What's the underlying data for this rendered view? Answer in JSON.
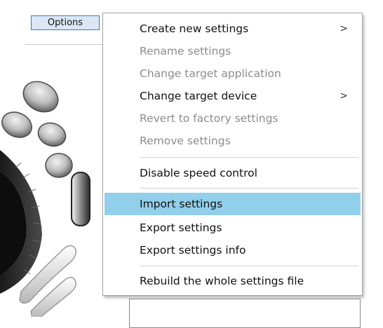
{
  "toolbar": {
    "options_label": "Options"
  },
  "menu": {
    "items": [
      {
        "label": "Create new settings",
        "enabled": true,
        "submenu": true,
        "highlighted": false
      },
      {
        "label": "Rename settings",
        "enabled": false,
        "submenu": false,
        "highlighted": false
      },
      {
        "label": "Change target application",
        "enabled": false,
        "submenu": false,
        "highlighted": false
      },
      {
        "label": "Change target device",
        "enabled": true,
        "submenu": true,
        "highlighted": false
      },
      {
        "label": "Revert to factory settings",
        "enabled": false,
        "submenu": false,
        "highlighted": false
      },
      {
        "label": "Remove settings",
        "enabled": false,
        "submenu": false,
        "highlighted": false
      },
      {
        "label": "Disable speed control",
        "enabled": true,
        "submenu": false,
        "highlighted": false
      },
      {
        "label": "Import settings",
        "enabled": true,
        "submenu": false,
        "highlighted": true
      },
      {
        "label": "Export settings",
        "enabled": true,
        "submenu": false,
        "highlighted": false
      },
      {
        "label": "Export settings info",
        "enabled": true,
        "submenu": false,
        "highlighted": false
      },
      {
        "label": "Rebuild the whole settings file",
        "enabled": true,
        "submenu": false,
        "highlighted": false
      }
    ],
    "submenu_arrow": ">"
  },
  "colors": {
    "highlight": "#91cfea",
    "disabled_text": "#8c8c8c",
    "enabled_text": "#111111",
    "options_border": "#3a78c6"
  }
}
